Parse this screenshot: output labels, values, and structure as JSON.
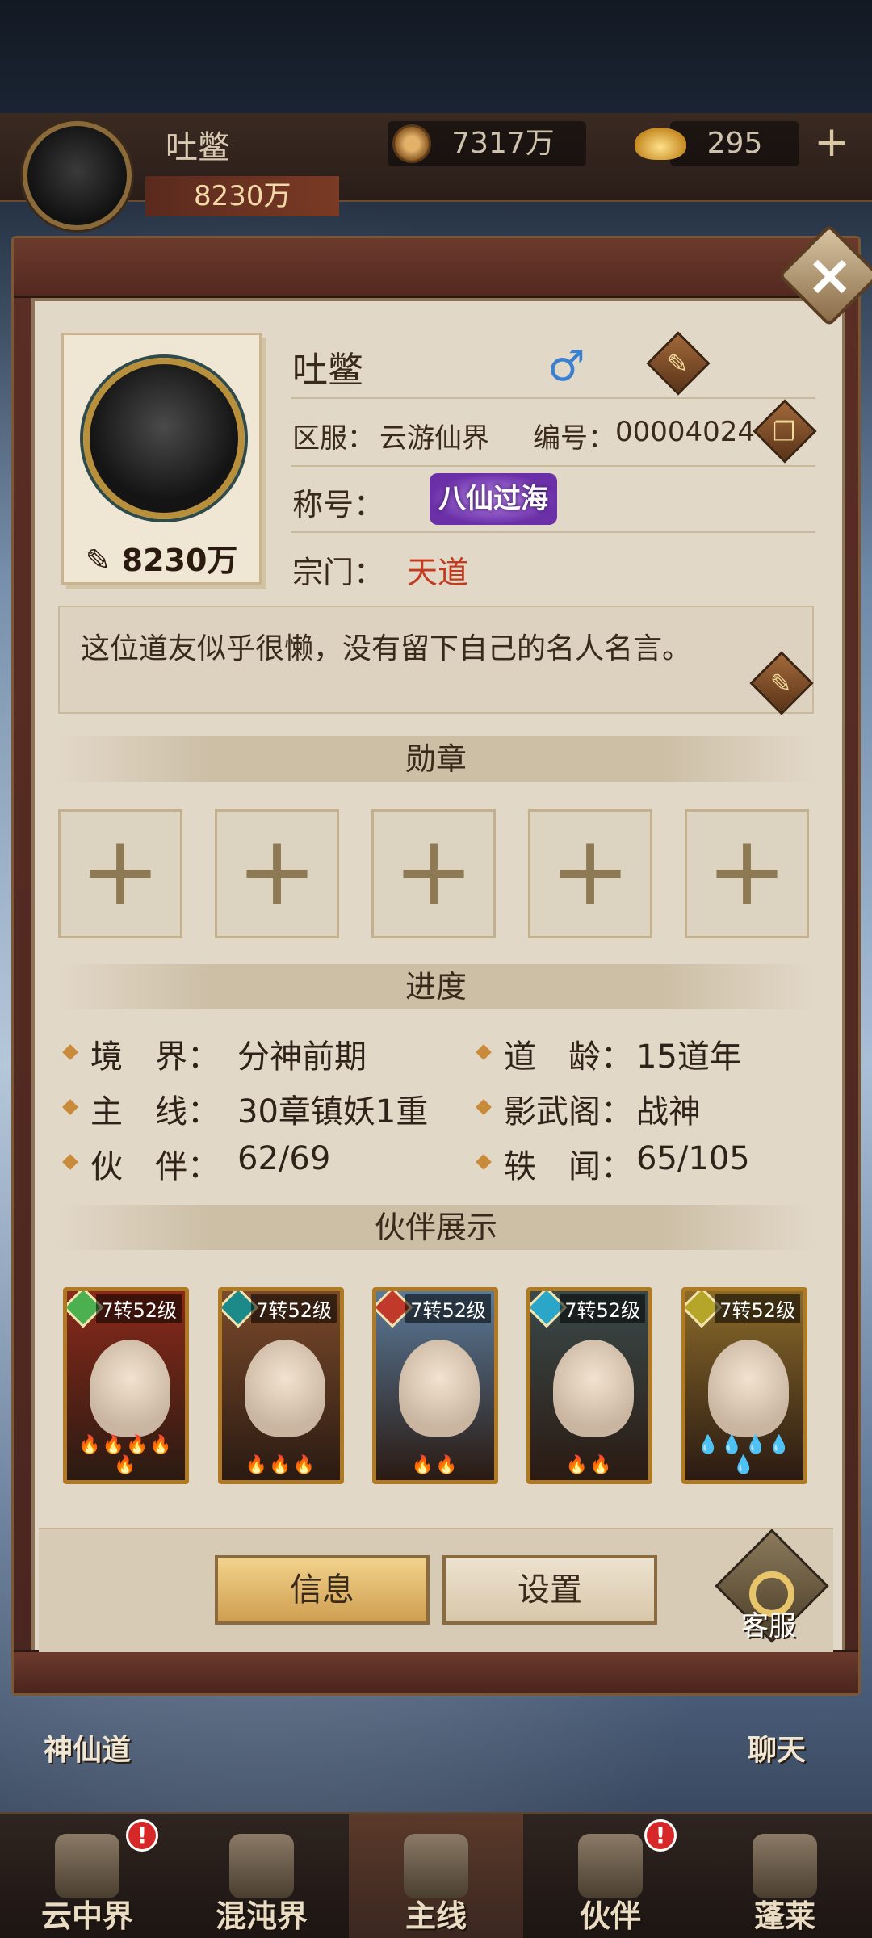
{
  "header": {
    "name": "吐鳖",
    "power": "8230万",
    "coins": "7317万",
    "ingots": "295",
    "add_icon": "plus-icon"
  },
  "profile": {
    "name": "吐鳖",
    "gender_symbol": "♂",
    "power": "8230万",
    "server_label": "区服：",
    "server_value": "云游仙界",
    "id_label": "编号：",
    "id_value": "00004024",
    "title_label": "称号：",
    "title_badge": "八仙过海",
    "sect_label": "宗门：",
    "sect_value": "天道",
    "motto": "这位道友似乎很懒，没有留下自己的名人名言。"
  },
  "sections": {
    "medals": "勋章",
    "progress": "进度",
    "partners": "伙伴展示"
  },
  "medal_slots": [
    "+",
    "+",
    "+",
    "+",
    "+"
  ],
  "progress": {
    "realm_label": "境　界：",
    "realm_value": "分神前期",
    "age_label": "道　龄：",
    "age_value": "15道年",
    "main_label": "主　线：",
    "main_value": "30章镇妖1重",
    "shadow_label": "影武阁：",
    "shadow_value": "战神",
    "partner_label": "伙　伴：",
    "partner_value": "62/69",
    "news_label": "轶　闻：",
    "news_value": "65/105"
  },
  "partners": [
    {
      "level": "7转52级",
      "stars": "🔥🔥🔥🔥🔥",
      "gem_color": "#4caf50",
      "bg": "#8a2a1a"
    },
    {
      "level": "7转52级",
      "stars": "🔥🔥🔥",
      "gem_color": "#1d8a8a",
      "bg": "#7a4a2a"
    },
    {
      "level": "7转52级",
      "stars": "🔥🔥",
      "gem_color": "#c0392b",
      "bg": "#5a7a9a"
    },
    {
      "level": "7转52级",
      "stars": "🔥🔥",
      "gem_color": "#2aa6c9",
      "bg": "#3a4a4a"
    },
    {
      "level": "7转52级",
      "stars": "💧💧💧💧💧",
      "gem_color": "#b5a62a",
      "bg": "#8a6a2a"
    }
  ],
  "buttons": {
    "info": "信息",
    "settings": "设置",
    "service": "客服"
  },
  "side_labels": {
    "left": "神仙道",
    "right": "聊天"
  },
  "nav": [
    {
      "label": "云中界",
      "badge": "!"
    },
    {
      "label": "混沌界",
      "badge": ""
    },
    {
      "label": "主线",
      "badge": ""
    },
    {
      "label": "伙伴",
      "badge": "!"
    },
    {
      "label": "蓬莱",
      "badge": ""
    }
  ]
}
